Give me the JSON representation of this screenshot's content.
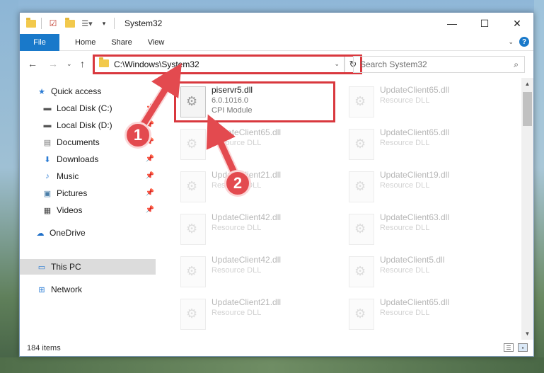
{
  "window": {
    "title": "System32",
    "buttons": {
      "minimize": "—",
      "maximize": "☐",
      "close": "✕"
    }
  },
  "ribbon": {
    "tabs": [
      "File",
      "Home",
      "Share",
      "View"
    ],
    "help": "?"
  },
  "address": {
    "path": "C:\\Windows\\System32",
    "search_placeholder": "Search System32"
  },
  "sidebar": {
    "items": [
      {
        "label": "Quick access",
        "icon": "star-icon",
        "pinned": false
      },
      {
        "label": "Local Disk (C:)",
        "icon": "drive-icon",
        "pinned": true
      },
      {
        "label": "Local Disk (D:)",
        "icon": "drive-icon",
        "pinned": true
      },
      {
        "label": "Documents",
        "icon": "documents-icon",
        "pinned": true
      },
      {
        "label": "Downloads",
        "icon": "download-icon",
        "pinned": true
      },
      {
        "label": "Music",
        "icon": "music-icon",
        "pinned": true
      },
      {
        "label": "Pictures",
        "icon": "pictures-icon",
        "pinned": true
      },
      {
        "label": "Videos",
        "icon": "videos-icon",
        "pinned": true
      },
      {
        "label": "OneDrive",
        "icon": "cloud-icon",
        "pinned": false
      },
      {
        "label": "This PC",
        "icon": "computer-icon",
        "pinned": false,
        "selected": true
      },
      {
        "label": "Network",
        "icon": "network-icon",
        "pinned": false
      }
    ]
  },
  "files": [
    {
      "name": "piservr5.dll",
      "version": "6.0.1016.0",
      "type": "CPI Module",
      "highlighted": true
    },
    {
      "name": "UpdateClient65.dll",
      "type": "Resource DLL"
    },
    {
      "name": "UpdateClient65.dll",
      "type": "Resource DLL"
    },
    {
      "name": "UpdateClient65.dll",
      "type": "Resource DLL"
    },
    {
      "name": "UpdateClient21.dll",
      "type": "Resource DLL"
    },
    {
      "name": "UpdateClient19.dll",
      "type": "Resource DLL"
    },
    {
      "name": "UpdateClient42.dll",
      "type": "Resource DLL"
    },
    {
      "name": "UpdateClient63.dll",
      "type": "Resource DLL"
    },
    {
      "name": "UpdateClient42.dll",
      "type": "Resource DLL"
    },
    {
      "name": "UpdateClient5.dll",
      "type": "Resource DLL"
    },
    {
      "name": "UpdateClient21.dll",
      "type": "Resource DLL"
    },
    {
      "name": "UpdateClient65.dll",
      "type": "Resource DLL"
    }
  ],
  "status": {
    "items": "184 items"
  },
  "callouts": [
    "1",
    "2"
  ],
  "colors": {
    "accent": "#1979ca",
    "annotation": "#d9383e",
    "callout": "#e34a4f"
  }
}
